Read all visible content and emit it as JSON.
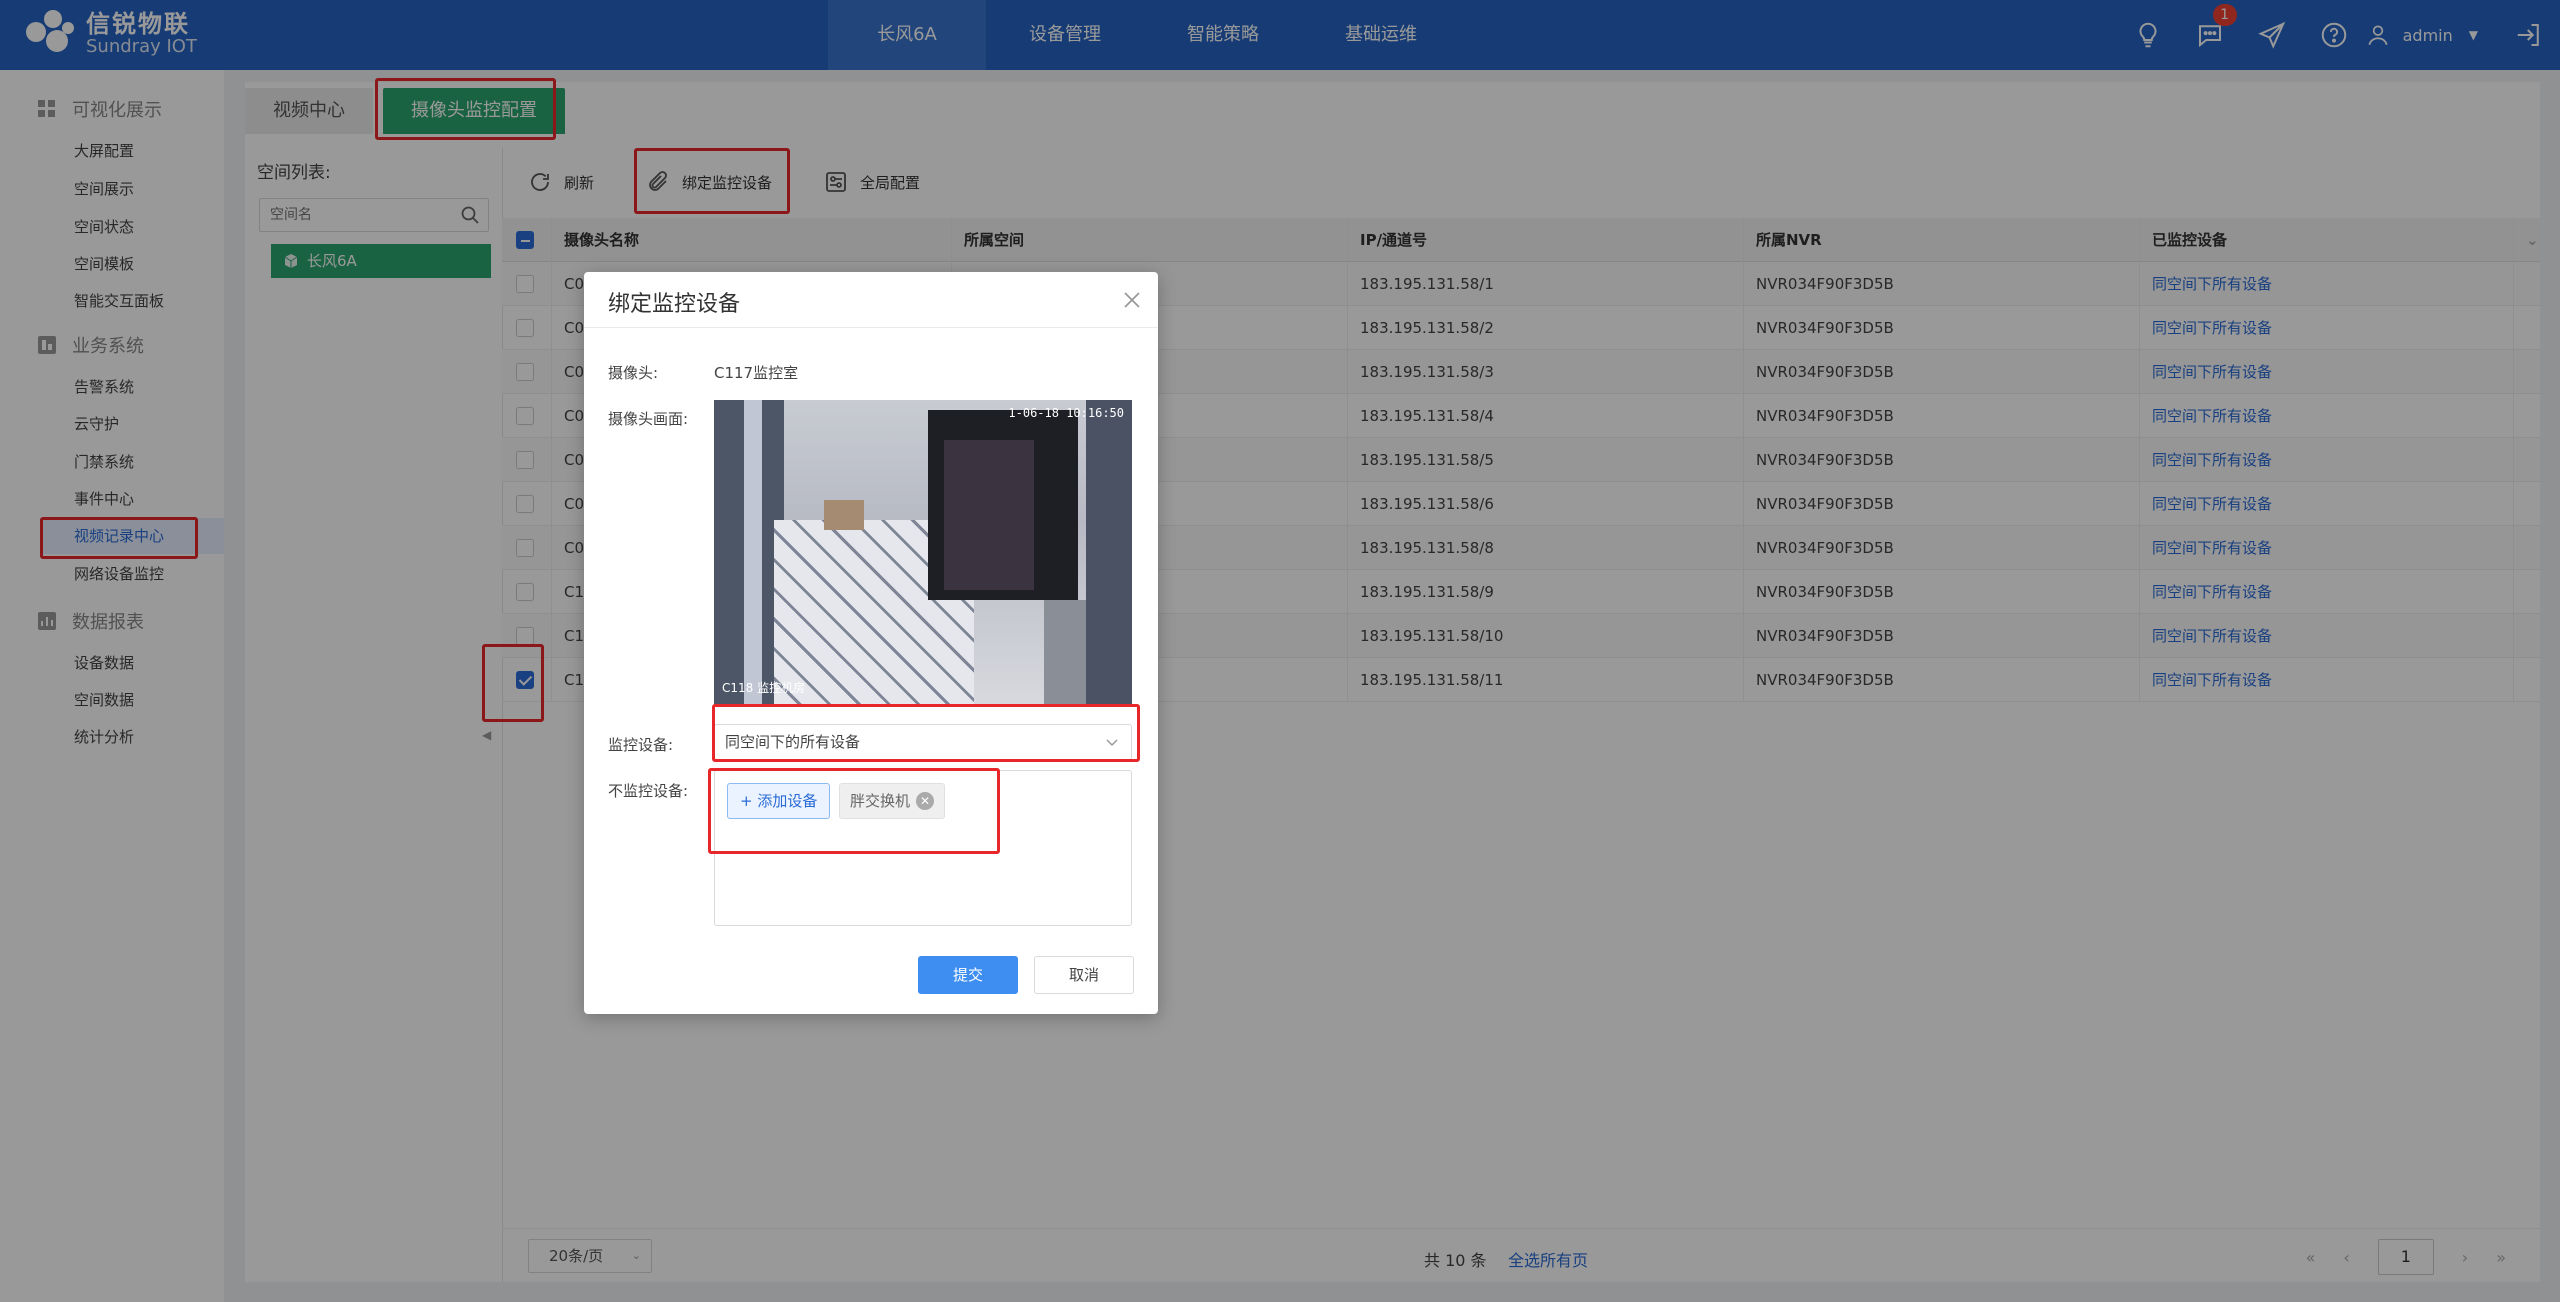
{
  "header": {
    "logo_cn": "信锐物联",
    "logo_en": "Sundray IOT",
    "nav": [
      "长风6A",
      "设备管理",
      "智能策略",
      "基础运维"
    ],
    "active_nav": 0,
    "message_badge": "1",
    "username": "admin"
  },
  "sidebar": {
    "groups": [
      {
        "title": "可视化展示",
        "items": [
          "大屏配置",
          "空间展示",
          "空间状态",
          "空间模板",
          "智能交互面板"
        ]
      },
      {
        "title": "业务系统",
        "items": [
          "告警系统",
          "云守护",
          "门禁系统",
          "事件中心",
          "视频记录中心",
          "网络设备监控"
        ]
      },
      {
        "title": "数据报表",
        "items": [
          "设备数据",
          "空间数据",
          "统计分析"
        ]
      }
    ],
    "active_item": "视频记录中心"
  },
  "tabs": [
    "视频中心",
    "摄像头监控配置"
  ],
  "left_panel": {
    "title": "空间列表:",
    "search_placeholder": "空间名",
    "node": "长风6A"
  },
  "toolbar": {
    "refresh": "刷新",
    "bind": "绑定监控设备",
    "global": "全局配置"
  },
  "table": {
    "headers": [
      "摄像头名称",
      "所属空间",
      "IP/通道号",
      "所属NVR",
      "已监控设备"
    ],
    "rows": [
      {
        "name": "C0",
        "ip": "183.195.131.58/1",
        "nvr": "NVR034F90F3D5B",
        "dev": "同空间下所有设备",
        "checked": false
      },
      {
        "name": "C0",
        "ip": "183.195.131.58/2",
        "nvr": "NVR034F90F3D5B",
        "dev": "同空间下所有设备",
        "checked": false
      },
      {
        "name": "C0",
        "ip": "183.195.131.58/3",
        "nvr": "NVR034F90F3D5B",
        "dev": "同空间下所有设备",
        "checked": false
      },
      {
        "name": "C0",
        "ip": "183.195.131.58/4",
        "nvr": "NVR034F90F3D5B",
        "dev": "同空间下所有设备",
        "checked": false
      },
      {
        "name": "C0",
        "ip": "183.195.131.58/5",
        "nvr": "NVR034F90F3D5B",
        "dev": "同空间下所有设备",
        "checked": false
      },
      {
        "name": "C0",
        "ip": "183.195.131.58/6",
        "nvr": "NVR034F90F3D5B",
        "dev": "同空间下所有设备",
        "checked": false
      },
      {
        "name": "C0",
        "ip": "183.195.131.58/8",
        "nvr": "NVR034F90F3D5B",
        "dev": "同空间下所有设备",
        "checked": false
      },
      {
        "name": "C1",
        "ip": "183.195.131.58/9",
        "nvr": "NVR034F90F3D5B",
        "dev": "同空间下所有设备",
        "checked": false
      },
      {
        "name": "C1",
        "ip": "183.195.131.58/10",
        "nvr": "NVR034F90F3D5B",
        "dev": "同空间下所有设备",
        "checked": false
      },
      {
        "name": "C1",
        "ip": "183.195.131.58/11",
        "nvr": "NVR034F90F3D5B",
        "dev": "同空间下所有设备",
        "checked": true
      }
    ]
  },
  "footer": {
    "page_size": "20条/页",
    "total": "共 10 条",
    "select_all": "全选所有页",
    "page": "1"
  },
  "modal": {
    "title": "绑定监控设备",
    "camera_label": "摄像头:",
    "camera_value": "C117监控室",
    "frame_label": "摄像头画面:",
    "frame_timestamp": "1-06-18 10:16:50",
    "frame_tag": "C118 监控机房",
    "monitor_label": "监控设备:",
    "monitor_value": "同空间下的所有设备",
    "exclude_label": "不监控设备:",
    "add_device": "+ 添加设备",
    "device_tag": "胖交换机",
    "submit": "提交",
    "cancel": "取消"
  },
  "colors": {
    "header": "#2563c4",
    "accent_green": "#2ca56e",
    "link_blue": "#2b6bd6",
    "primary_button": "#3d8ef0",
    "highlight": "#e8272a"
  }
}
